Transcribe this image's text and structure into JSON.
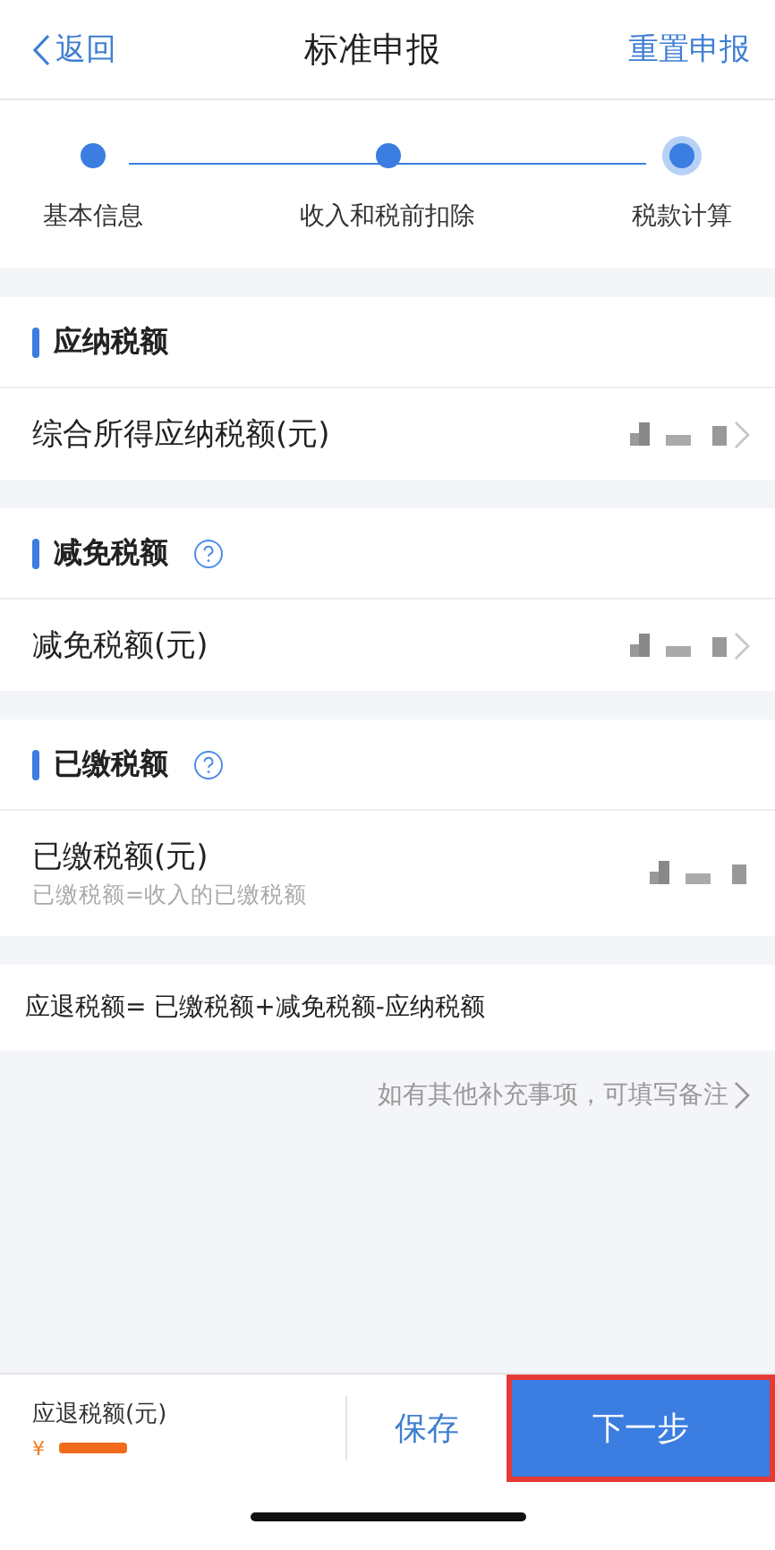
{
  "nav": {
    "back": "返回",
    "title": "标准申报",
    "action": "重置申报"
  },
  "steps": [
    {
      "label": "基本信息",
      "selected": false
    },
    {
      "label": "收入和税前扣除",
      "selected": false
    },
    {
      "label": "税款计算",
      "selected": true
    }
  ],
  "sections": [
    {
      "title": "应纳税额",
      "help": false,
      "row": {
        "label": "综合所得应纳税额(元)",
        "chevron": true
      }
    },
    {
      "title": "减免税额",
      "help": true,
      "row": {
        "label": "减免税额(元)",
        "chevron": true
      }
    },
    {
      "title": "已缴税额",
      "help": true,
      "row": {
        "label": "已缴税额(元)",
        "sub": "已缴税额=收入的已缴税额",
        "chevron": false
      }
    }
  ],
  "formula": "应退税额= 已缴税额+减免税额-应纳税额",
  "remark_link": "如有其他补充事项，可填写备注",
  "bottom_bar": {
    "label": "应退税额(元)",
    "currency": "¥",
    "save": "保存",
    "next": "下一步",
    "next_highlighted": true
  }
}
